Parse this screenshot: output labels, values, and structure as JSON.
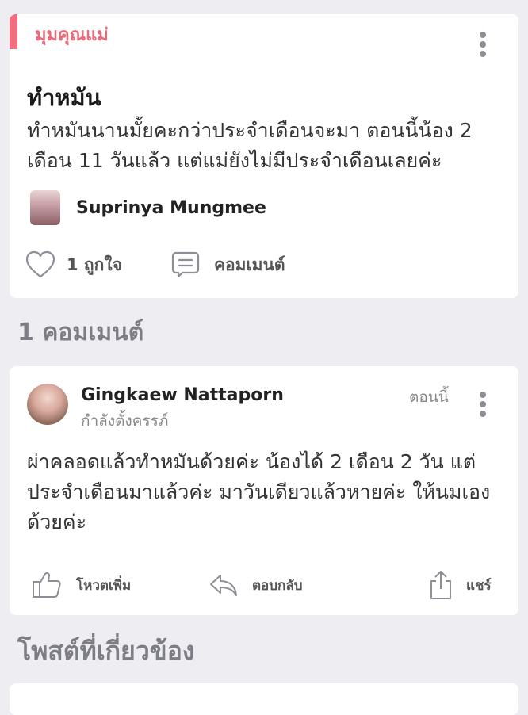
{
  "post": {
    "category": "มุมคุณแม่",
    "title": "ทำหมัน",
    "body": "ทำหมันนานมั้ยคะกว่าประจำเดือนจะมา ตอนนี้น้อง 2 เดือน 11 วันแล้ว แต่แม่ยังไม่มีประจำเดือนเลยค่ะ",
    "author": "Suprinya Mungmee",
    "like_label": "1 ถูกใจ",
    "comment_label": "คอมเมนต์",
    "icons": {
      "menu": "more-vertical-icon",
      "like": "heart-icon",
      "comment": "speech-bubble-icon"
    }
  },
  "comments_section": {
    "heading": "1 คอมเมนต์",
    "comments": [
      {
        "author": "Gingkaew Nattaporn",
        "status": "กำลังตั้งครรภ์",
        "time": "ตอนนี้",
        "body": "ผ่าคลอดแล้วทำหมันด้วยค่ะ น้องได้ 2 เดือน 2 วัน แต่ประจำเดือนมาแล้วค่ะ มาวันเดียวแล้วหายค่ะ ให้นมเองด้วยค่ะ",
        "upvote_label": "โหวตเพิ่ม",
        "reply_label": "ตอบกลับ",
        "share_label": "แชร์"
      }
    ]
  },
  "related": {
    "heading": "โพสต์ที่เกี่ยวข้อง"
  },
  "colors": {
    "accent": "#f26d7d",
    "background": "#eeedf2",
    "card": "#ffffff",
    "muted": "#7d7d86"
  }
}
